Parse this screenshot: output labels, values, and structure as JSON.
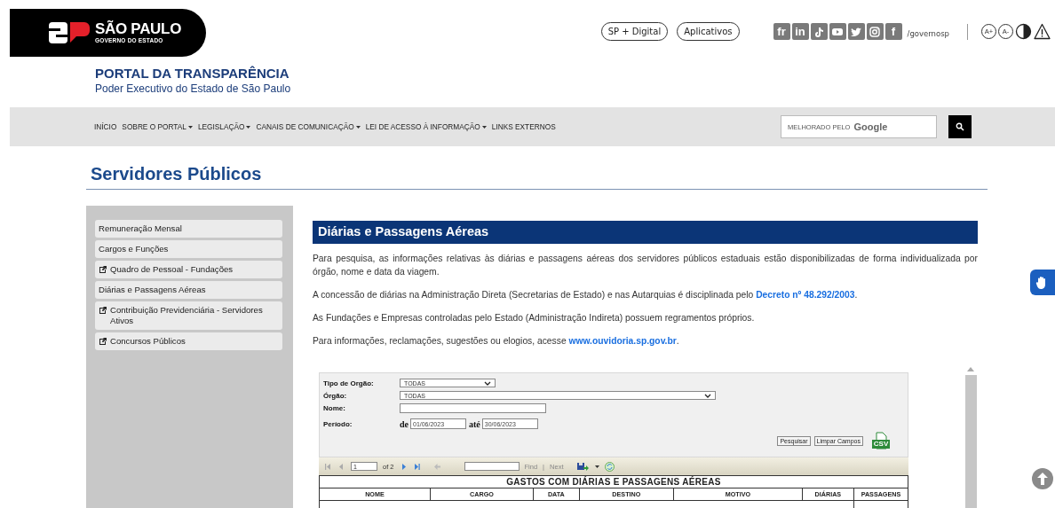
{
  "logo": {
    "title": "SÃO PAULO",
    "subtitle": "GOVERNO DO ESTADO"
  },
  "top_links": [
    "SP + Digital",
    "Aplicativos"
  ],
  "social": [
    {
      "kind": "text",
      "label": "fr"
    },
    {
      "kind": "text",
      "label": "in"
    },
    {
      "kind": "tiktok"
    },
    {
      "kind": "youtube"
    },
    {
      "kind": "twitter"
    },
    {
      "kind": "instagram"
    },
    {
      "kind": "text",
      "label": "f"
    }
  ],
  "social_handle": "/governosp",
  "accessibility": [
    {
      "kind": "text",
      "label": "A+"
    },
    {
      "kind": "text",
      "label": "A-"
    },
    {
      "kind": "contrast"
    },
    {
      "kind": "warning"
    }
  ],
  "portal": {
    "title": "PORTAL DA TRANSPARÊNCIA",
    "subtitle": "Poder Executivo do Estado de São Paulo"
  },
  "nav": [
    {
      "label": "INÍCIO",
      "dropdown": false
    },
    {
      "label": "SOBRE O PORTAL",
      "dropdown": true
    },
    {
      "label": "LEGISLAÇÃO",
      "dropdown": true
    },
    {
      "label": "CANAIS DE COMUNICAÇÃO",
      "dropdown": true
    },
    {
      "label": "LEI DE ACESSO À INFORMAÇÃO",
      "dropdown": true
    },
    {
      "label": "LINKS EXTERNOS",
      "dropdown": false
    }
  ],
  "search": {
    "label": "MELHORADO PELO",
    "brand": "Google"
  },
  "page_title": "Servidores Públicos",
  "sidebar": {
    "items": [
      {
        "label": "Remuneração Mensal",
        "external": false
      },
      {
        "label": "Cargos e Funções",
        "external": false
      },
      {
        "label": "Quadro de Pessoal - Fundações",
        "external": true
      },
      {
        "label": "Diárias e Passagens Aéreas",
        "external": false
      },
      {
        "label": "Contribuição Previdenciária - Servidores Ativos",
        "external": true
      },
      {
        "label": "Concursos Públicos",
        "external": true
      }
    ]
  },
  "section_title": "Diárias e Passagens Aéreas",
  "paragraphs": [
    {
      "text": "Para pesquisa, as informações relativas às diárias e passagens aéreas dos servidores públicos estaduais estão disponibilizadas de forma individualizada por órgão, nome e data da viagem."
    },
    {
      "text": "A concessão de diárias na Administração Direta (Secretarias de Estado) e nas Autarquias é disciplinada pelo ",
      "link": "Decreto nº 48.292/2003",
      "after": "."
    },
    {
      "text": "As Fundações e Empresas controladas pelo Estado (Administração Indireta) possuem regramentos próprios."
    },
    {
      "text": "Para informações, reclamações, sugestões ou elogios, acesse ",
      "link": "www.ouvidoria.sp.gov.br",
      "after": "."
    }
  ],
  "report": {
    "filters": [
      {
        "label": "Tipo de Orgão:",
        "kind": "select",
        "value": "TODAS"
      },
      {
        "label": "Órgão:",
        "kind": "select",
        "value": "TODAS"
      },
      {
        "label": "Nome:",
        "kind": "text"
      },
      {
        "label": "Período:",
        "kind": "range",
        "from_label": "de",
        "from": "01/06/2023",
        "to_label": "até",
        "to": "30/06/2023"
      }
    ],
    "buttons": [
      "Pesquisar",
      "Limpar Campos"
    ],
    "csv_label": "CSV",
    "toolbar": {
      "page": "1",
      "of_pages": "of 2",
      "find": "Find",
      "separator": "|",
      "next": "Next"
    },
    "table": {
      "title": "GASTOS COM DIÁRIAS E PASSAGENS AÉREAS",
      "columns": [
        "NOME",
        "CARGO",
        "DATA",
        "DESTINO",
        "MOTIVO",
        "DIÁRIAS",
        "PASSAGENS"
      ]
    }
  }
}
